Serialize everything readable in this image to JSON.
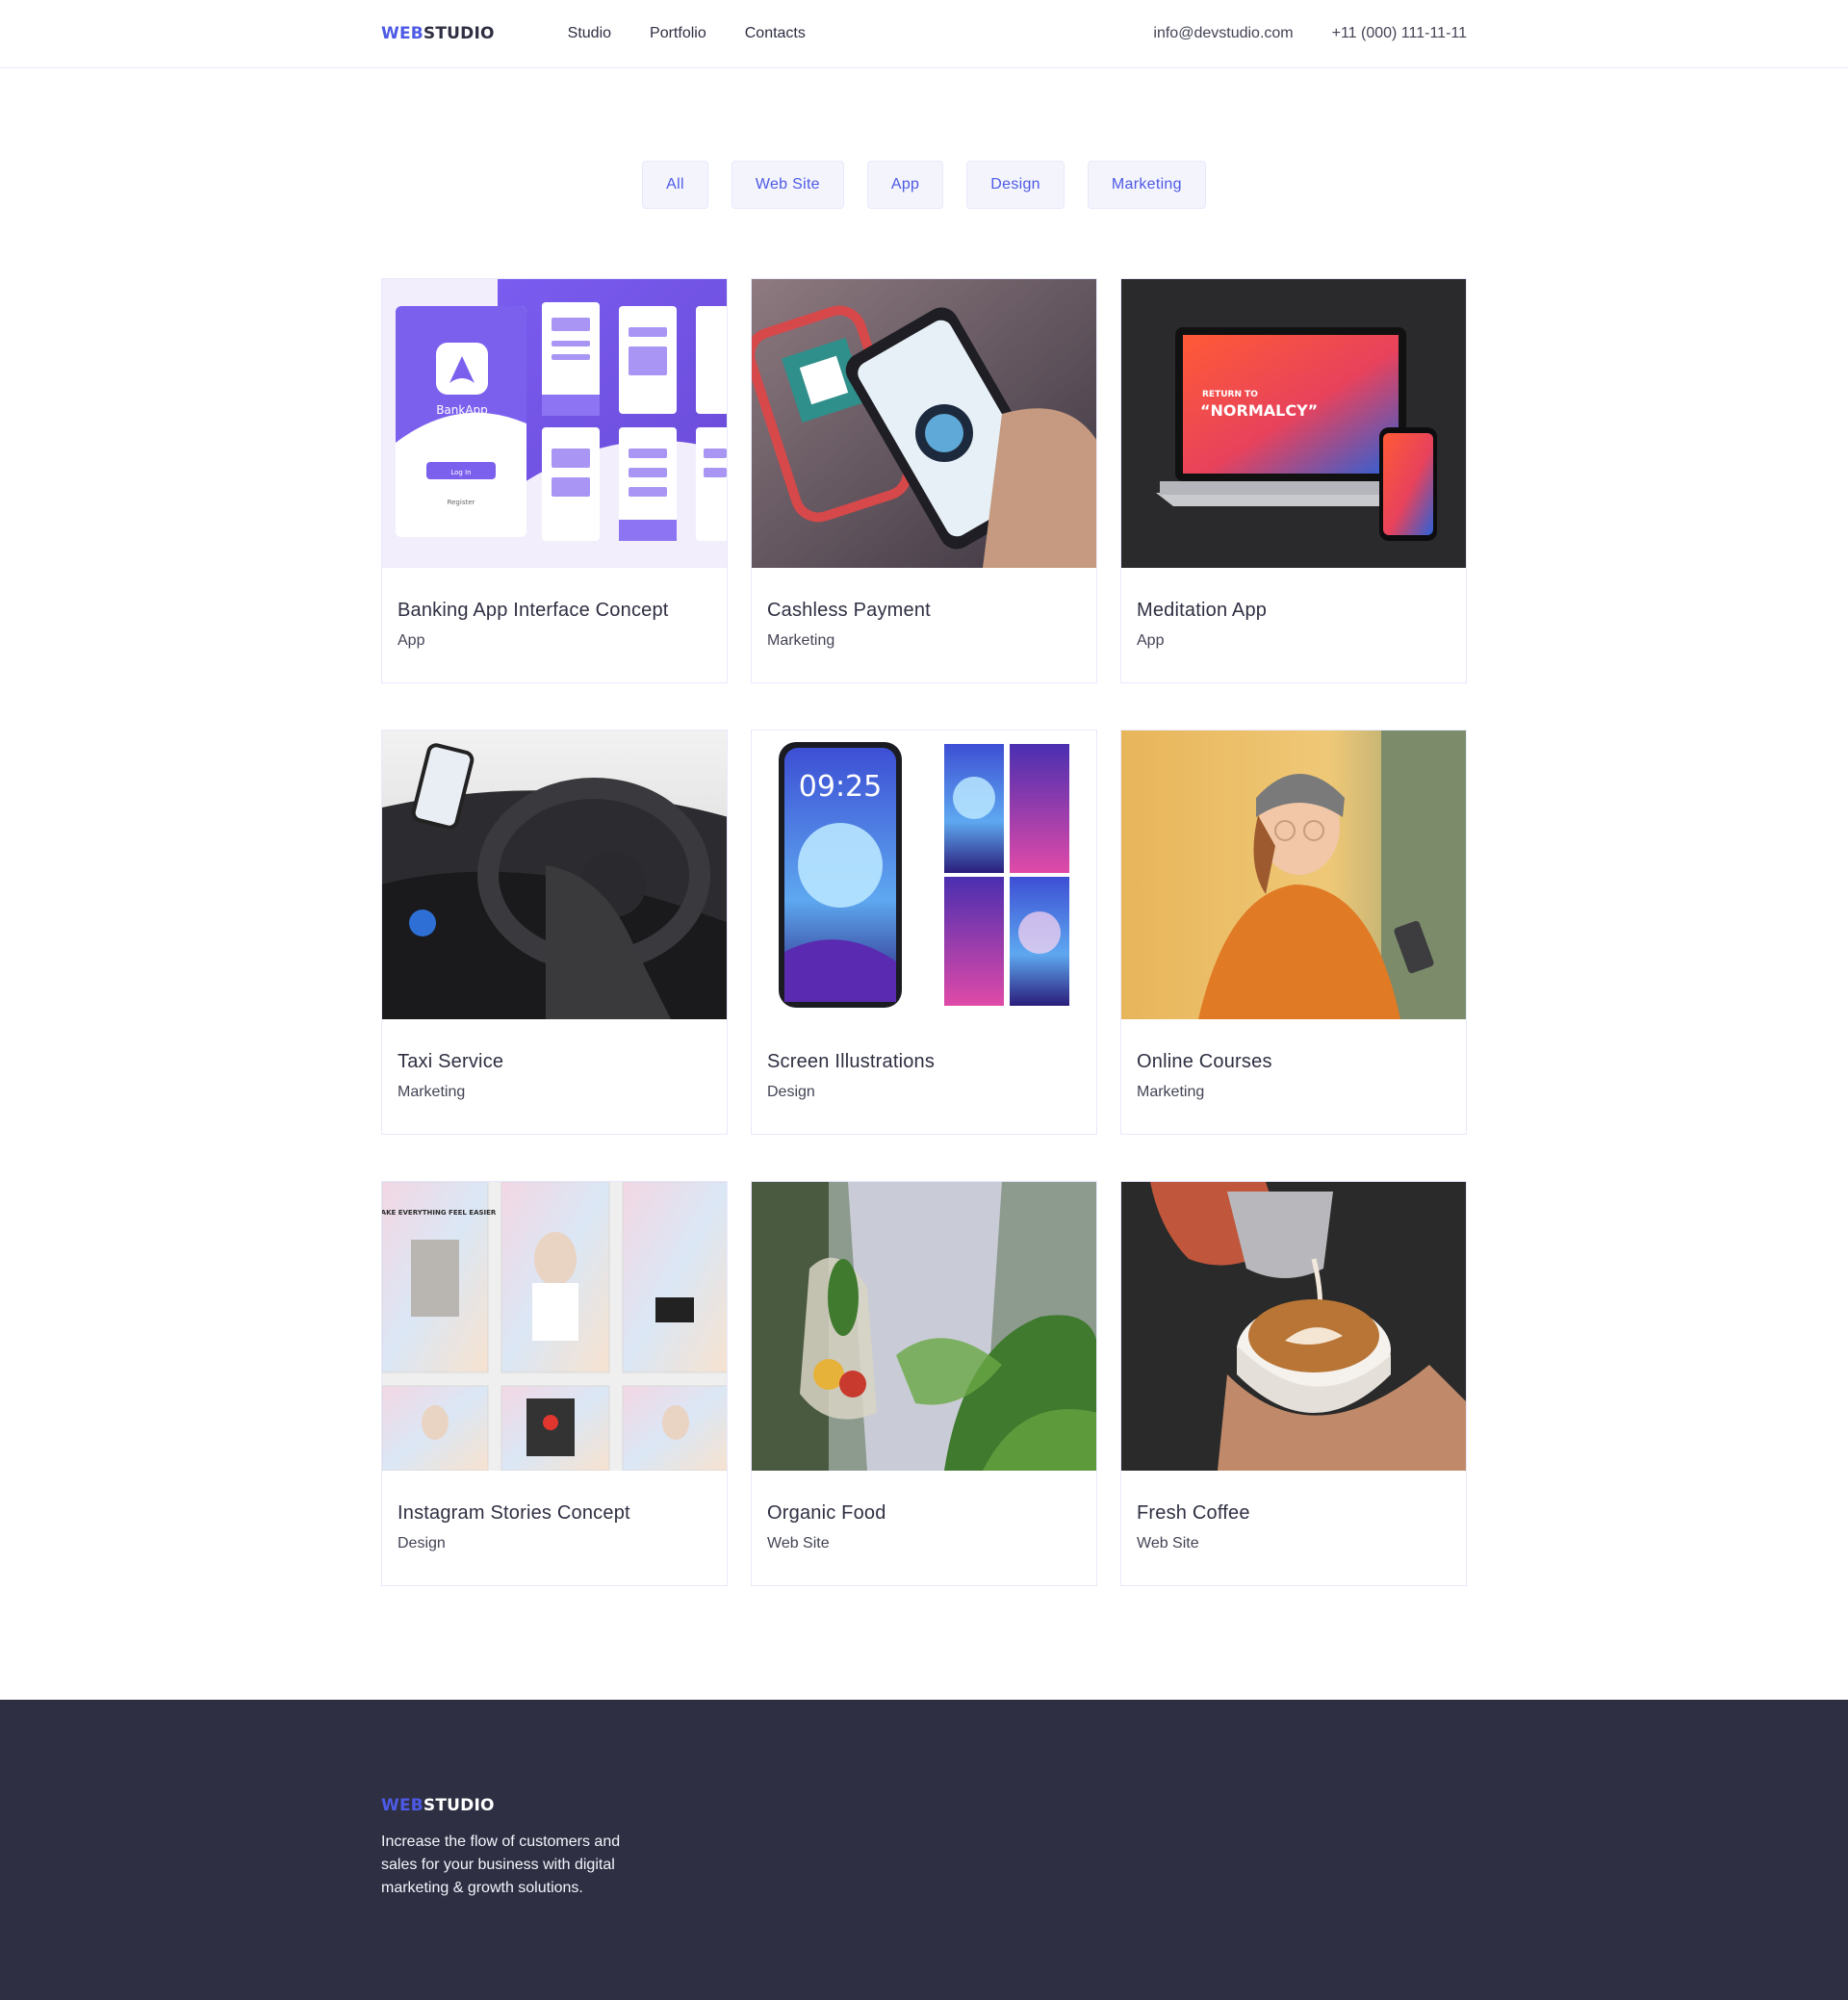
{
  "header": {
    "logo_accent": "WEB",
    "logo_rest": "STUDIO",
    "nav": [
      "Studio",
      "Portfolio",
      "Contacts"
    ],
    "email": "info@devstudio.com",
    "phone": "+11 (000) 111-11-11"
  },
  "filters": [
    "All",
    "Web Site",
    "App",
    "Design",
    "Marketing"
  ],
  "projects": [
    {
      "title": "Banking App Interface Concept",
      "tag": "App"
    },
    {
      "title": "Cashless Payment",
      "tag": "Marketing"
    },
    {
      "title": "Meditation App",
      "tag": "App"
    },
    {
      "title": "Taxi Service",
      "tag": "Marketing"
    },
    {
      "title": "Screen Illustrations",
      "tag": "Design"
    },
    {
      "title": "Online Courses",
      "tag": "Marketing"
    },
    {
      "title": "Instagram Stories Concept",
      "tag": "Design"
    },
    {
      "title": "Organic Food",
      "tag": "Web Site"
    },
    {
      "title": "Fresh Coffee",
      "tag": "Web Site"
    }
  ],
  "images": {
    "bankapp_label": "BankApp",
    "bankapp_login": "Log In",
    "bankapp_register": "Register",
    "meditation_line1": "RETURN TO",
    "meditation_line2": "“NORMALCY”",
    "screen_time": "09:25",
    "insta_headline": "MAKE EVERYTHING FEEL EASIER"
  },
  "footer": {
    "logo_accent": "WEB",
    "logo_rest": "STUDIO",
    "text": "Increase the flow of customers and sales for your business with digital marketing & growth solutions."
  },
  "colors": {
    "accent": "#4d5ae5",
    "dark": "#2e2f42",
    "filter_bg": "#f4f4fd"
  }
}
